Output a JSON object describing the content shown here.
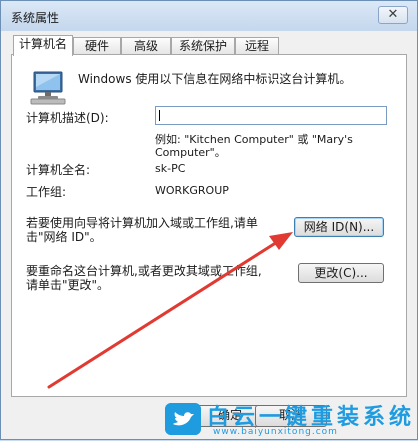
{
  "window": {
    "title": "系统属性",
    "close_glyph": "✕"
  },
  "tabs": [
    {
      "label": "计算机名",
      "active": true
    },
    {
      "label": "硬件"
    },
    {
      "label": "高级"
    },
    {
      "label": "系统保护"
    },
    {
      "label": "远程"
    }
  ],
  "intro_text": "Windows 使用以下信息在网络中标识这台计算机。",
  "fields": {
    "description_label": "计算机描述(D):",
    "description_value": "",
    "example_line1": "例如: \"Kitchen Computer\" 或 \"Mary's",
    "example_line2": "Computer\"。",
    "fullname_label": "计算机全名:",
    "fullname_value": "sk-PC",
    "workgroup_label": "工作组:",
    "workgroup_value": "WORKGROUP"
  },
  "network": {
    "text_line1": "若要使用向导将计算机加入域或工作组,请单",
    "text_line2": "击\"网络 ID\"。",
    "button_label": "网络 ID(N)..."
  },
  "rename": {
    "text_line1": "要重命名这台计算机,或者更改其域或工作组,",
    "text_line2": "请单击\"更改\"。",
    "button_label": "更改(C)..."
  },
  "footer": {
    "ok_label": "确定",
    "cancel_label": "取消"
  },
  "watermark": {
    "main": "白云一键重装系统",
    "sub": "www.baiyunxitong.com"
  },
  "colors": {
    "arrow": "#e03a32",
    "accent": "#1f9be0"
  },
  "icons": {
    "computer": "computer-icon",
    "close": "close-icon",
    "bird": "twitter-bird-icon"
  }
}
